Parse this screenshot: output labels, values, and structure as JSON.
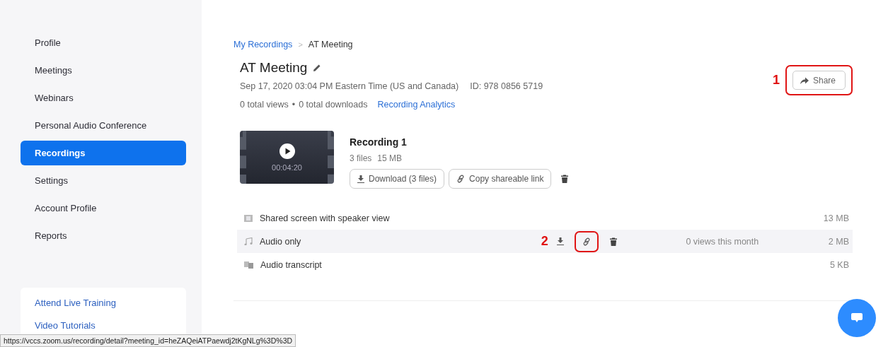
{
  "sidebar": {
    "items": [
      {
        "label": "Profile",
        "selected": false
      },
      {
        "label": "Meetings",
        "selected": false
      },
      {
        "label": "Webinars",
        "selected": false
      },
      {
        "label": "Personal Audio Conference",
        "selected": false
      },
      {
        "label": "Recordings",
        "selected": true
      },
      {
        "label": "Settings",
        "selected": false
      },
      {
        "label": "Account Profile",
        "selected": false
      },
      {
        "label": "Reports",
        "selected": false
      }
    ],
    "help_links": [
      "Attend Live Training",
      "Video Tutorials"
    ]
  },
  "breadcrumb": {
    "parent": "My Recordings",
    "separator": ">",
    "current": "AT Meeting"
  },
  "meeting": {
    "title": "AT Meeting",
    "date": "Sep 17, 2020 03:04 PM Eastern Time (US and Canada)",
    "id": "ID: 978 0856 5719",
    "views": "0 total views",
    "dot": "•",
    "downloads": "0 total downloads",
    "analytics_link": "Recording Analytics"
  },
  "share_button": {
    "label": "Share",
    "callout": "1"
  },
  "recording": {
    "title": "Recording 1",
    "duration": "00:04:20",
    "files_count": "3 files",
    "size": "15 MB",
    "download_button": "Download (3 files)",
    "copy_link_button": "Copy shareable link"
  },
  "files": [
    {
      "kind": "video",
      "name": "Shared screen with speaker view",
      "size": "13 MB",
      "selected": false
    },
    {
      "kind": "audio",
      "name": "Audio only",
      "size": "2 MB",
      "selected": true,
      "callout": "2",
      "views": "0 views this month"
    },
    {
      "kind": "transcript",
      "name": "Audio transcript",
      "size": "5 KB",
      "selected": false
    }
  ],
  "status_bar": {
    "url": "https://vccs.zoom.us/recording/detail?meeting_id=heZAQeiATPaewdj2tKgNLg%3D%3D"
  }
}
